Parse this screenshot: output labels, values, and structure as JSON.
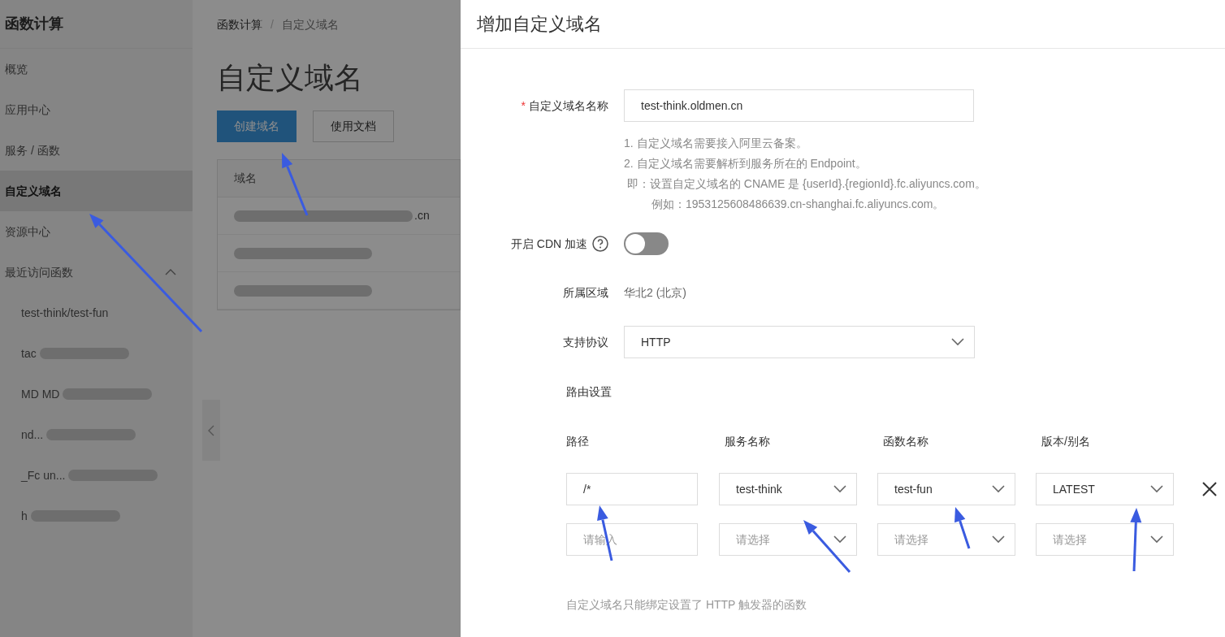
{
  "sidebar": {
    "title": "函数计算",
    "items": [
      {
        "label": "概览",
        "selected": false
      },
      {
        "label": "应用中心",
        "selected": false
      },
      {
        "label": "服务 / 函数",
        "selected": false
      },
      {
        "label": "自定义域名",
        "selected": true
      },
      {
        "label": "资源中心",
        "selected": false
      }
    ],
    "recent": {
      "label": "最近访问函数",
      "expanded": true,
      "items": [
        {
          "text": "test-think/test-fun",
          "redacted": false
        },
        {
          "text": "tac",
          "redacted": true
        },
        {
          "text": "MD  MD",
          "redacted": true
        },
        {
          "text": "nd...",
          "redacted": true
        },
        {
          "text": "_Fc  un...",
          "redacted": true
        },
        {
          "text": "h",
          "redacted": true
        }
      ]
    }
  },
  "breadcrumb": {
    "items": [
      "函数计算",
      "自定义域名"
    ],
    "separator": "/"
  },
  "page": {
    "title": "自定义域名",
    "buttons": [
      {
        "label": "创建域名",
        "kind": "primary"
      },
      {
        "label": "使用文档",
        "kind": "default"
      }
    ],
    "table": {
      "columns": [
        "域名"
      ],
      "rows": [
        {
          "text": ".cn",
          "redacted": true
        },
        {
          "redacted": true
        },
        {
          "redacted": true
        }
      ]
    }
  },
  "drawer": {
    "title": "增加自定义域名",
    "domain": {
      "label": "自定义域名名称",
      "required_mark": "*",
      "value": "test-think.oldmen.cn",
      "hints": [
        "1. 自定义域名需要接入阿里云备案。",
        "2. 自定义域名需要解析到服务所在的 Endpoint。",
        " 即：设置自定义域名的 CNAME 是 {userId}.{regionId}.fc.aliyuncs.com。",
        "例如：1953125608486639.cn-shanghai.fc.aliyuncs.com。"
      ]
    },
    "cdn": {
      "label": "开启 CDN 加速",
      "on": false
    },
    "region": {
      "label": "所属区域",
      "value": "华北2 (北京)"
    },
    "protocol": {
      "label": "支持协议",
      "value": "HTTP"
    },
    "routes": {
      "label": "路由设置",
      "columns": [
        "路径",
        "服务名称",
        "函数名称",
        "版本/别名"
      ],
      "rows": [
        {
          "path": {
            "value": "/*"
          },
          "service": {
            "value": "test-think"
          },
          "function": {
            "value": "test-fun"
          },
          "version": {
            "value": "LATEST"
          },
          "removable": true
        },
        {
          "path": {
            "placeholder": "请输入"
          },
          "service": {
            "placeholder": "请选择"
          },
          "function": {
            "placeholder": "请选择"
          },
          "version": {
            "placeholder": "请选择"
          },
          "removable": false
        }
      ]
    },
    "note": "自定义域名只能绑定设置了 HTTP 触发器的函数"
  }
}
